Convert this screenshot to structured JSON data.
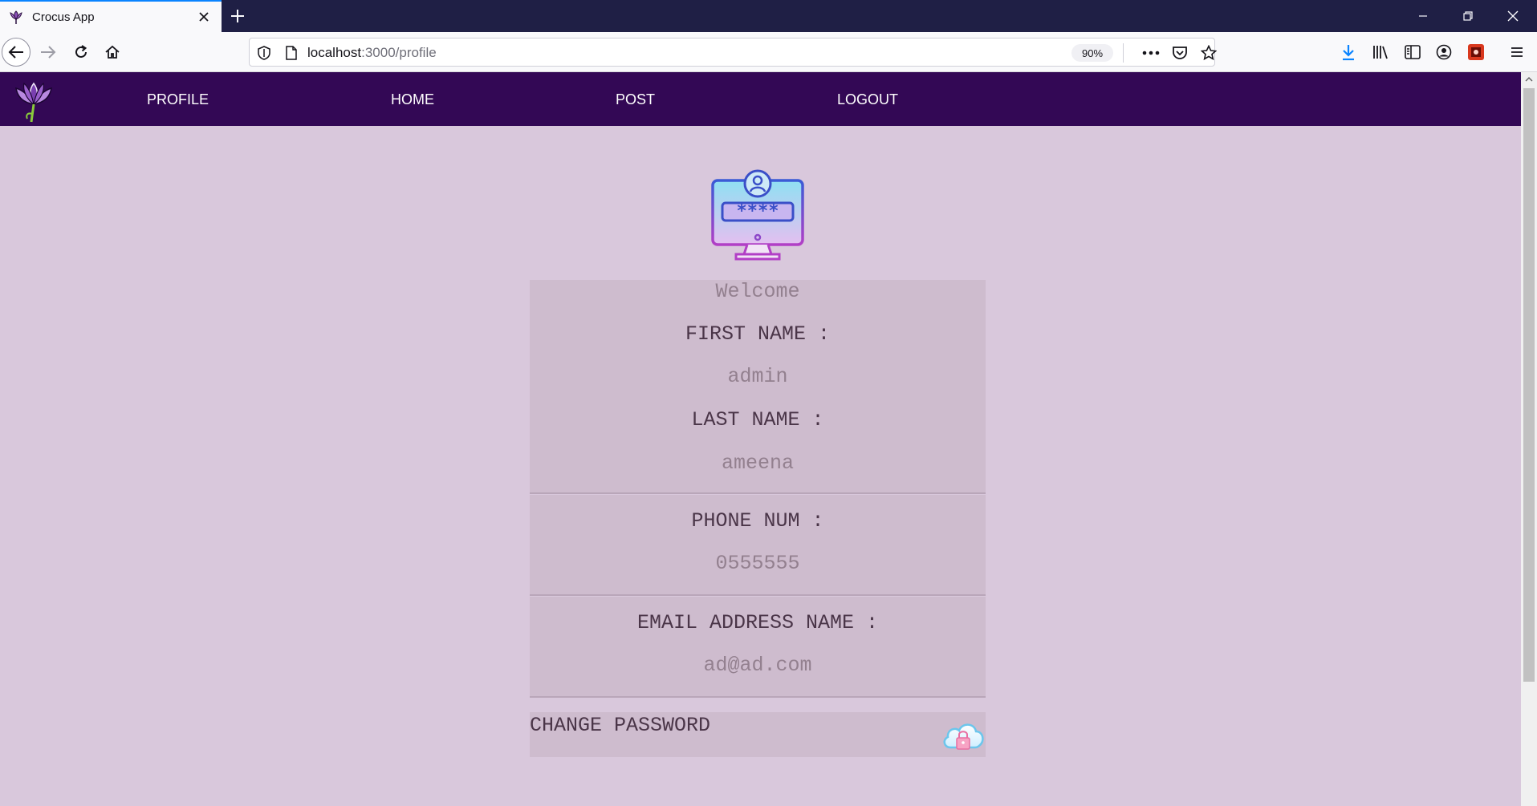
{
  "browser": {
    "tab_title": "Crocus App",
    "url_host": "localhost",
    "url_path": ":3000/profile",
    "zoom": "90%"
  },
  "app_nav": {
    "links": [
      "PROFILE",
      "HOME",
      "POST",
      "LOGOUT"
    ]
  },
  "profile": {
    "welcome": "Welcome",
    "first_name_label": "FIRST NAME :",
    "first_name_value": "admin",
    "last_name_label": "LAST NAME :",
    "last_name_value": "ameena",
    "phone_label": "PHONE NUM :",
    "phone_value": "0555555",
    "email_label": "EMAIL ADDRESS NAME :",
    "email_value": "ad@ad.com",
    "change_password": "CHANGE PASSWORD"
  },
  "colors": {
    "app_nav_bg": "#330855",
    "page_bg": "#d9c8dc",
    "card_bg": "#cebcce"
  }
}
